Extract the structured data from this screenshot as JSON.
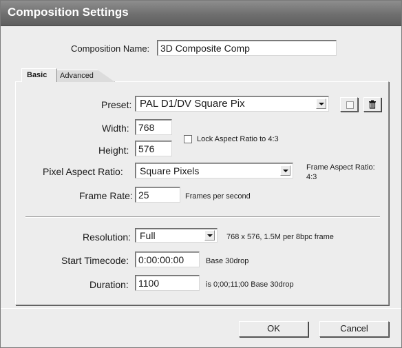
{
  "window": {
    "title": "Composition Settings"
  },
  "composition_name": {
    "label": "Composition Name:",
    "value": "3D Composite Comp"
  },
  "tabs": [
    {
      "label": "Basic",
      "active": true
    },
    {
      "label": "Advanced",
      "active": false
    }
  ],
  "basic": {
    "preset": {
      "label": "Preset:",
      "value": "PAL D1/DV Square Pix",
      "save_icon": "save-preset-icon",
      "delete_icon": "trash-icon"
    },
    "width": {
      "label": "Width:",
      "value": "768"
    },
    "height": {
      "label": "Height:",
      "value": "576"
    },
    "lock_aspect": {
      "label": "Lock Aspect Ratio to 4:3",
      "checked": false
    },
    "pixel_aspect": {
      "label": "Pixel Aspect Ratio:",
      "value": "Square Pixels"
    },
    "frame_aspect": {
      "label": "Frame Aspect Ratio:",
      "value": "4:3"
    },
    "frame_rate": {
      "label": "Frame Rate:",
      "value": "25",
      "unit": "Frames per second"
    },
    "resolution": {
      "label": "Resolution:",
      "value": "Full",
      "info": "768 x 576, 1.5M per 8bpc frame"
    },
    "start_timecode": {
      "label": "Start Timecode:",
      "value": "0:00:00:00",
      "info": "Base 30drop"
    },
    "duration": {
      "label": "Duration:",
      "value": "1100",
      "info": "is 0;00;11;00  Base 30drop"
    }
  },
  "buttons": {
    "ok": "OK",
    "cancel": "Cancel"
  }
}
